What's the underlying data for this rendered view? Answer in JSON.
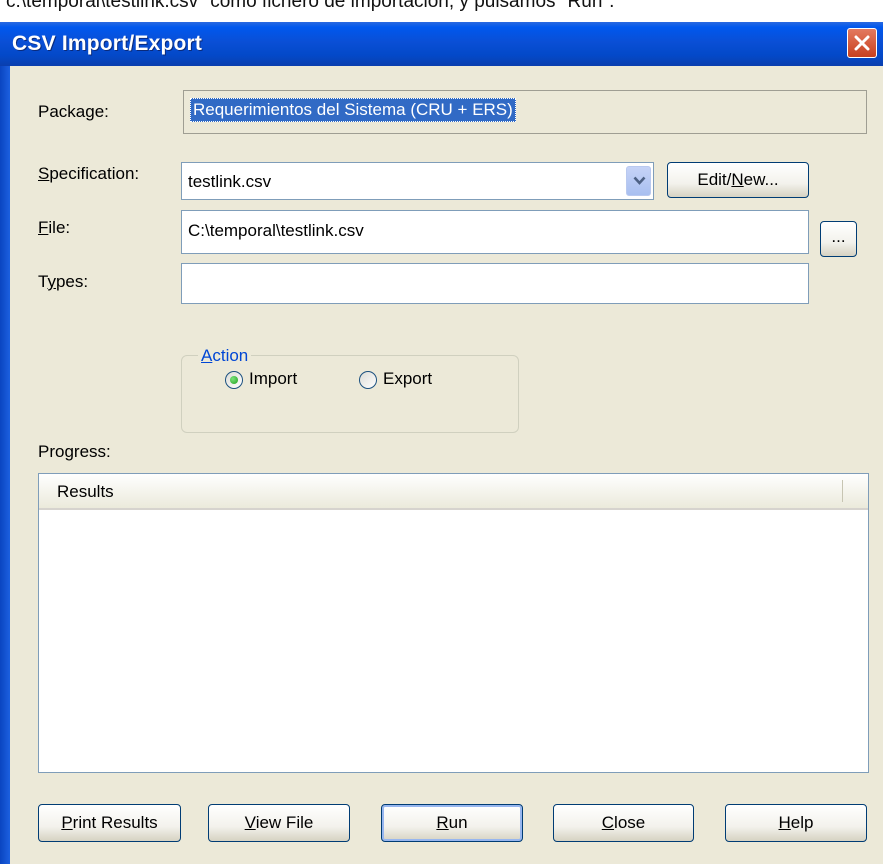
{
  "doc_context": "c:\\temporal\\testlink.csv\" como fichero de importación, y pulsamos \"Run\".",
  "window": {
    "title": "CSV Import/Export"
  },
  "labels": {
    "package": "Package:",
    "specification": {
      "before": "",
      "underline": "S",
      "after": "pecification:"
    },
    "file": {
      "before": "",
      "underline": "F",
      "after": "ile:"
    },
    "types": {
      "before": "T",
      "underline": "y",
      "after": "pes:"
    },
    "progress": "Progress:"
  },
  "package_value": "Requerimientos del Sistema (CRU + ERS)",
  "specification_value": "testlink.csv",
  "edit_new_button": {
    "before": "Edit/",
    "underline": "N",
    "after": "ew..."
  },
  "file_value": "C:\\temporal\\testlink.csv",
  "browse_button_label": "...",
  "types_value": "",
  "action": {
    "legend": {
      "underline": "A",
      "after": "ction"
    },
    "options": [
      "Import",
      "Export"
    ],
    "selected": "Import"
  },
  "results_table": {
    "columns": [
      "Results"
    ],
    "rows": []
  },
  "buttons": {
    "print_results": {
      "underline": "P",
      "after": "rint Results"
    },
    "view_file": {
      "underline": "V",
      "after": "iew File"
    },
    "run": {
      "underline": "R",
      "after": "un"
    },
    "close": {
      "underline": "C",
      "after": "lose"
    },
    "help": {
      "underline": "H",
      "after": "elp"
    }
  }
}
